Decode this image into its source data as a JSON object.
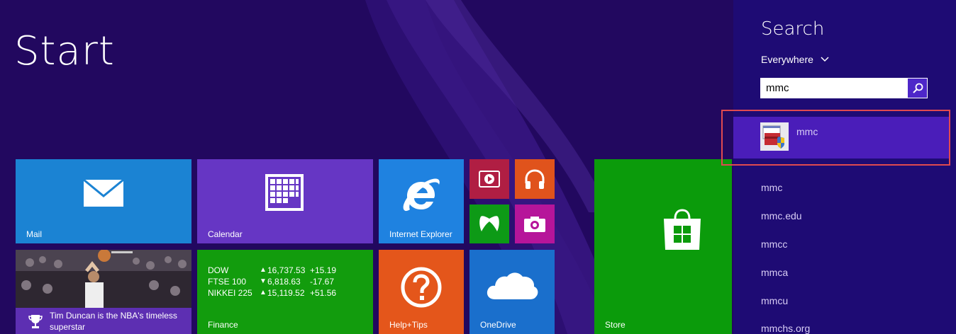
{
  "start": {
    "title": "Start"
  },
  "tiles": {
    "mail": {
      "label": "Mail",
      "color": "#1b83d3"
    },
    "calendar": {
      "label": "Calendar",
      "color": "#6636c4"
    },
    "ie": {
      "label": "Internet Explorer",
      "color": "#1f82e0"
    },
    "video": {
      "color": "#b01e43"
    },
    "music": {
      "color": "#e0531c"
    },
    "games": {
      "color": "#0d9a16"
    },
    "camera": {
      "color": "#b6159a"
    },
    "store": {
      "label": "Store",
      "color": "#0b9b0b"
    },
    "sports": {
      "caption": "Tim Duncan is the NBA's timeless superstar",
      "caption_color": "#5d2fb2"
    },
    "finance": {
      "label": "Finance",
      "color": "#129c0d",
      "rows": [
        {
          "name": "DOW",
          "arrow": "▲",
          "value": "16,737.53",
          "change": "+15.19"
        },
        {
          "name": "FTSE 100",
          "arrow": "▼",
          "value": "6,818.63",
          "change": "-17.67"
        },
        {
          "name": "NIKKEI 225",
          "arrow": "▲",
          "value": "15,119.52",
          "change": "+51.56"
        }
      ]
    },
    "help": {
      "label": "Help+Tips",
      "color": "#e4561b"
    },
    "onedrive": {
      "label": "OneDrive",
      "color": "#1a6fcc"
    }
  },
  "search": {
    "title": "Search",
    "scope": "Everywhere",
    "query": "mmc",
    "top_result": "mmc",
    "suggestions": [
      "mmc",
      "mmc.edu",
      "mmcc",
      "mmca",
      "mmcu",
      "mmchs.org"
    ]
  },
  "icons": {
    "scope_chevron": "chevron-down-icon",
    "search_button": "search-icon"
  }
}
